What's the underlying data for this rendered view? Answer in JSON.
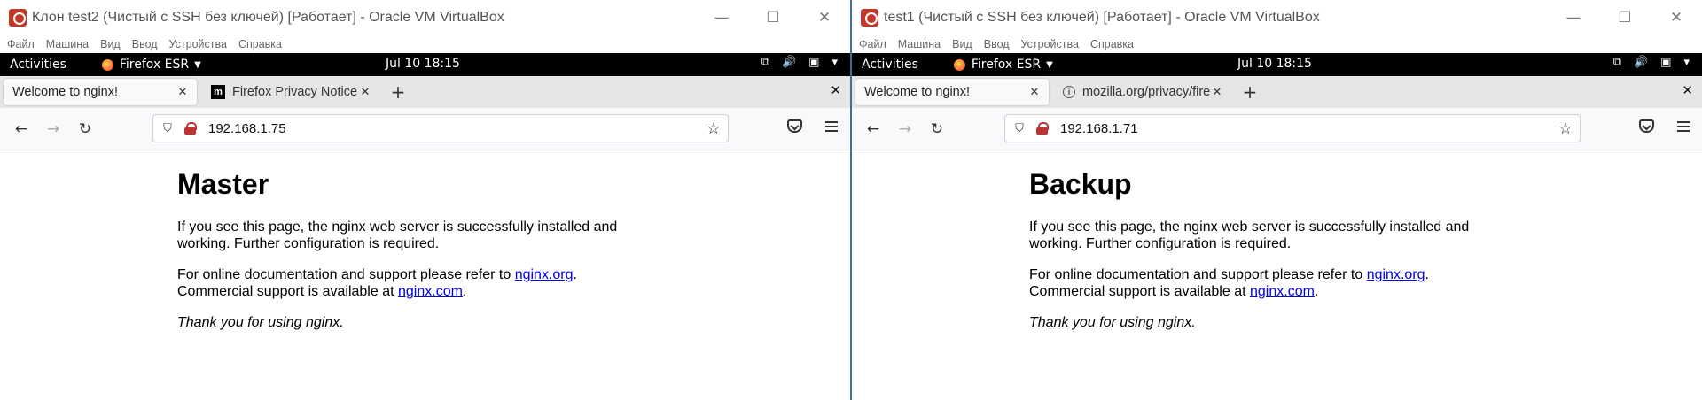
{
  "windows": [
    {
      "title": "Клон test2 (Чистый с SSH без ключей) [Работает] - Oracle VM VirtualBox",
      "menu": [
        "Файл",
        "Машина",
        "Вид",
        "Ввод",
        "Устройства",
        "Справка"
      ],
      "gnome": {
        "activities": "Activities",
        "app": "Firefox ESR",
        "clock": "Jul 10  18:15"
      },
      "tabs": [
        {
          "label": "Welcome to nginx!",
          "favicon": "none",
          "active": true
        },
        {
          "label": "Firefox Privacy Notice —",
          "favicon": "m",
          "active": false
        }
      ],
      "url": "192.168.1.75",
      "page": {
        "heading": "Master",
        "p1": "If you see this page, the nginx web server is successfully installed and working. Further configuration is required.",
        "p2_a": "For online documentation and support please refer to ",
        "p2_link": "nginx.org",
        "p2_b": ".",
        "p2_c": "Commercial support is available at ",
        "p2_link2": "nginx.com",
        "p2_d": ".",
        "p3": "Thank you for using nginx."
      }
    },
    {
      "title": "test1 (Чистый с SSH без ключей) [Работает] - Oracle VM VirtualBox",
      "menu": [
        "Файл",
        "Машина",
        "Вид",
        "Ввод",
        "Устройства",
        "Справка"
      ],
      "gnome": {
        "activities": "Activities",
        "app": "Firefox ESR",
        "clock": "Jul 10  18:15"
      },
      "tabs": [
        {
          "label": "Welcome to nginx!",
          "favicon": "none",
          "active": true
        },
        {
          "label": "mozilla.org/privacy/firefo",
          "favicon": "info",
          "active": false
        }
      ],
      "url": "192.168.1.71",
      "page": {
        "heading": "Backup",
        "p1": "If you see this page, the nginx web server is successfully installed and working. Further configuration is required.",
        "p2_a": "For online documentation and support please refer to ",
        "p2_link": "nginx.org",
        "p2_b": ".",
        "p2_c": "Commercial support is available at ",
        "p2_link2": "nginx.com",
        "p2_d": ".",
        "p3": "Thank you for using nginx."
      }
    }
  ],
  "icons": {
    "window_minimize": "—",
    "window_maximize": "☐",
    "window_close": "✕",
    "tab_close": "✕",
    "new_tab": "+",
    "list_all_tabs": "✕",
    "back": "←",
    "forward": "→",
    "reload": "↻",
    "star": "☆",
    "network": "⧉",
    "volume": "🔊",
    "battery": "▣",
    "status_menu": "▾"
  },
  "colors": {
    "accent_link": "#0000ee",
    "gnome_bar": "#000000",
    "vbox_border": "#3b6ea5"
  }
}
